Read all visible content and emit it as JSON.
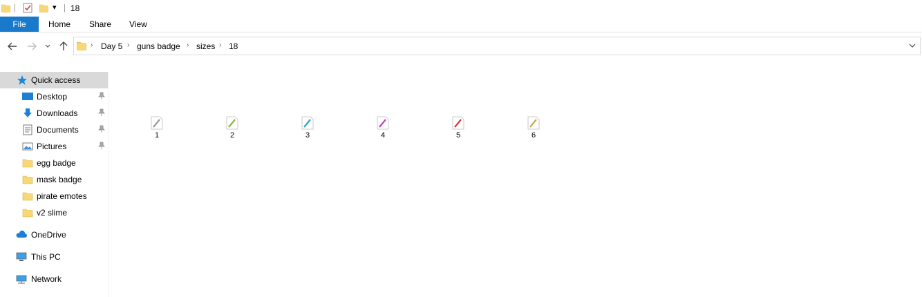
{
  "window": {
    "title": "18"
  },
  "ribbon": {
    "tabs": {
      "file": "File",
      "home": "Home",
      "share": "Share",
      "view": "View"
    }
  },
  "address": {
    "crumbs": [
      "Day 5",
      "guns badge",
      "sizes",
      "18"
    ]
  },
  "sidebar": {
    "quick_access": "Quick access",
    "pinned": [
      {
        "label": "Desktop",
        "icon": "desktop-icon"
      },
      {
        "label": "Downloads",
        "icon": "downloads-icon"
      },
      {
        "label": "Documents",
        "icon": "documents-icon"
      },
      {
        "label": "Pictures",
        "icon": "pictures-icon"
      }
    ],
    "folders": [
      "egg badge",
      "mask badge",
      "pirate emotes",
      "v2 slime"
    ],
    "onedrive": "OneDrive",
    "thispc": "This PC",
    "network": "Network"
  },
  "files": [
    {
      "name": "1",
      "color": "#9a9a9a"
    },
    {
      "name": "2",
      "color": "#8bb63a"
    },
    {
      "name": "3",
      "color": "#2aa3c9"
    },
    {
      "name": "4",
      "color": "#c13fc1"
    },
    {
      "name": "5",
      "color": "#d9363a"
    },
    {
      "name": "6",
      "color": "#c9a64a"
    }
  ]
}
